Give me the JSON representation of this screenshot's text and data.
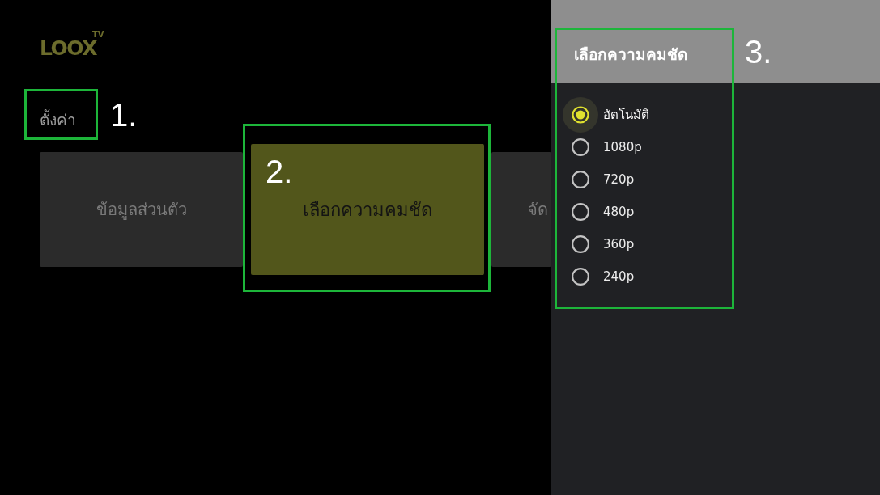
{
  "logo": {
    "wordmark": "LOOX",
    "superscript": "TV"
  },
  "page_title": "ตั้งค่า",
  "menu_cards": [
    {
      "label": "ข้อมูลส่วนตัว",
      "selected": false
    },
    {
      "label": "เลือกความคมชัด",
      "selected": true
    },
    {
      "label": "จัด",
      "selected": false
    }
  ],
  "quality_panel": {
    "title": "เลือกความคมชัด",
    "options": [
      {
        "label": "อัตโนมัติ",
        "selected": true,
        "focused": true
      },
      {
        "label": "1080p",
        "selected": false,
        "focused": false
      },
      {
        "label": "720p",
        "selected": false,
        "focused": false
      },
      {
        "label": "480p",
        "selected": false,
        "focused": false
      },
      {
        "label": "360p",
        "selected": false,
        "focused": false
      },
      {
        "label": "240p",
        "selected": false,
        "focused": false
      }
    ]
  },
  "annotations": [
    {
      "label": "1."
    },
    {
      "label": "2."
    },
    {
      "label": "3."
    }
  ]
}
